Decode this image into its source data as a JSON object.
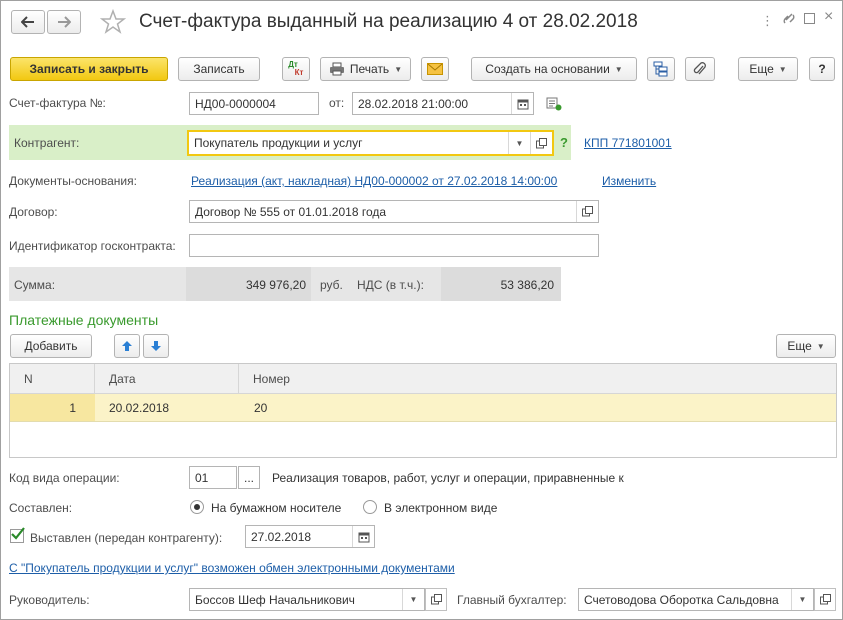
{
  "window": {
    "title": "Счет-фактура выданный на реализацию 4 от 28.02.2018"
  },
  "toolbar": {
    "save_close": "Записать и закрыть",
    "save": "Записать",
    "dtkt_top": "Дт",
    "dtkt_bottom": "Кт",
    "print": "Печать",
    "create_based": "Создать на основании",
    "more": "Еще",
    "help": "?"
  },
  "invoice": {
    "number_label": "Счет-фактура №:",
    "number": "НД00-0000004",
    "date_label": "от:",
    "date": "28.02.2018 21:00:00"
  },
  "contractor": {
    "label": "Контрагент:",
    "value": "Покупатель продукции и услуг",
    "help": "?",
    "kpp_link": "КПП 771801001"
  },
  "base_docs": {
    "label": "Документы-основания:",
    "link": "Реализация (акт, накладная) НД00-000002 от 27.02.2018 14:00:00",
    "change": "Изменить"
  },
  "contract": {
    "label": "Договор:",
    "value": "Договор № 555 от 01.01.2018 года"
  },
  "gov_contract": {
    "label": "Идентификатор госконтракта:",
    "value": ""
  },
  "totals": {
    "sum_label": "Сумма:",
    "sum": "349 976,20",
    "currency": "руб.",
    "vat_label": "НДС (в т.ч.):",
    "vat": "53 386,20"
  },
  "payments": {
    "title": "Платежные документы",
    "add": "Добавить",
    "more": "Еще",
    "columns": [
      "N",
      "Дата",
      "Номер"
    ],
    "rows": [
      {
        "n": "1",
        "date": "20.02.2018",
        "number": "20"
      }
    ]
  },
  "operation": {
    "label": "Код вида операции:",
    "code": "01",
    "ellipsis": "...",
    "description": "Реализация товаров, работ, услуг и операции, приравненные к"
  },
  "composed": {
    "label": "Составлен:",
    "paper": "На бумажном носителе",
    "electronic": "В электронном виде",
    "selected": "paper"
  },
  "issued": {
    "label": "Выставлен (передан контрагенту):",
    "checked": true,
    "date": "27.02.2018"
  },
  "edo_link": "С \"Покупатель продукции и услуг\" возможен обмен электронными документами",
  "signers": {
    "head_label": "Руководитель:",
    "head": "Боссов Шеф Начальникович",
    "accountant_label": "Главный бухгалтер:",
    "accountant": "Счетоводова Оборотка Сальдовна"
  },
  "colors": {
    "primary_button": "#f2c811",
    "link": "#1d5ea8",
    "section_title": "#3a9a2e",
    "contractor_bg": "#d9efc8",
    "selected_row": "#fbf3c8",
    "totals_bg": "#e6e6e6",
    "focus_border": "#f2c811"
  }
}
